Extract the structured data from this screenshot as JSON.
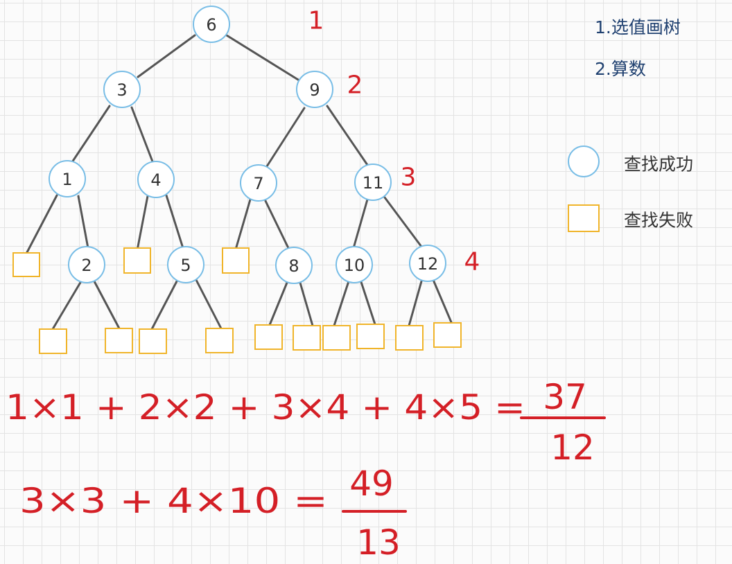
{
  "steps": [
    "1.选值画树",
    "2.算数"
  ],
  "legend": [
    {
      "shape": "circle",
      "label": "查找成功",
      "color": "#78bde6"
    },
    {
      "shape": "square",
      "label": "查找失败",
      "color": "#f0b429"
    }
  ],
  "level_labels": [
    "1",
    "2",
    "3",
    "4"
  ],
  "tree": {
    "nodes": [
      "6",
      "3",
      "9",
      "1",
      "4",
      "7",
      "11",
      "2",
      "5",
      "8",
      "10",
      "12"
    ],
    "edges": [
      [
        "6",
        "3"
      ],
      [
        "6",
        "9"
      ],
      [
        "3",
        "1"
      ],
      [
        "3",
        "4"
      ],
      [
        "9",
        "7"
      ],
      [
        "9",
        "11"
      ],
      [
        "1",
        "2"
      ],
      [
        "4",
        "5"
      ],
      [
        "7",
        "8"
      ],
      [
        "11",
        "10"
      ],
      [
        "11",
        "12"
      ]
    ],
    "failure_box_count": 13
  },
  "formulas": [
    {
      "expression": "1×1 + 2×2 + 3×4 + 4×5 =",
      "numerator": "37",
      "denominator": "12"
    },
    {
      "expression": "3×3 + 4×10 =",
      "numerator": "49",
      "denominator": "13"
    }
  ],
  "colors": {
    "success_stroke": "#78bde6",
    "failure_stroke": "#f0b429",
    "annotation_red": "#d41f26",
    "step_blue": "#1f4070",
    "edge_gray": "#555555"
  }
}
